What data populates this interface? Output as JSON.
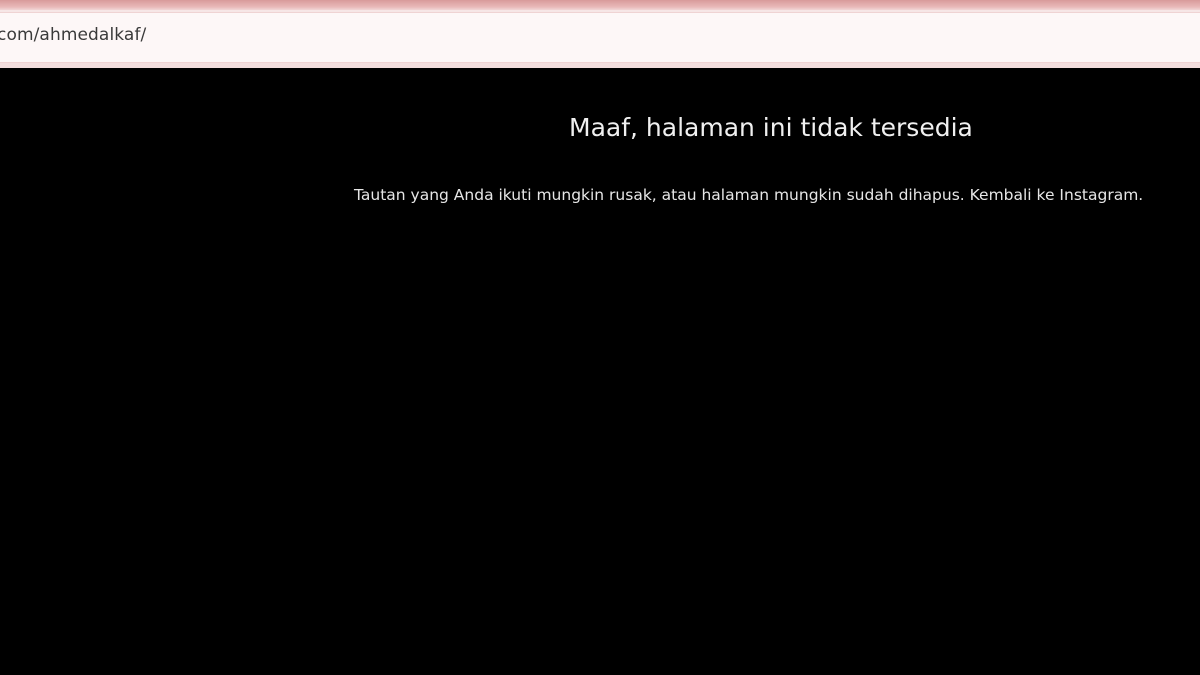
{
  "browser": {
    "url": "com/ahmedalkaf/"
  },
  "error_page": {
    "title": "Maaf, halaman ini tidak tersedia",
    "message": "Tautan yang Anda ikuti mungkin rusak, atau halaman mungkin sudah dihapus. ",
    "link_text": "Kembali ke Instagram."
  },
  "colors": {
    "background": "#000000",
    "text": "#f0f0f0",
    "chrome": "#f6e6e6"
  }
}
